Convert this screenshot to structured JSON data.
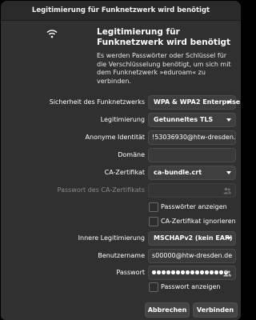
{
  "window": {
    "title": "Legitimierung für Funknetzwerk wird benötigt"
  },
  "header": {
    "icon": "wifi-icon",
    "title": "Legitimierung für Funknetzwerk wird benötigt",
    "description": "Es werden Passwörter oder Schlüssel für die Verschlüsselung benötigt, um sich mit dem Funknetzwerk »eduroam« zu verbinden."
  },
  "form": {
    "security": {
      "label": "Sicherheit des Funknetzwerks",
      "value": "WPA & WPA2 Enterprise"
    },
    "authentication": {
      "label": "Legitimierung",
      "value": "Getunneltes TLS"
    },
    "anonymous_identity": {
      "label": "Anonyme Identität",
      "value": "!53036930@htw-dresden.de"
    },
    "domain": {
      "label": "Domäne",
      "value": ""
    },
    "ca_certificate": {
      "label": "CA-Zertifikat",
      "value": "ca-bundle.crt"
    },
    "ca_password": {
      "label": "Passwort des CA-Zertifikats",
      "value": ""
    },
    "show_passwords": {
      "label": "Passwörter anzeigen",
      "checked": false
    },
    "ignore_ca": {
      "label": "CA-Zertifikat ignorieren",
      "checked": false
    },
    "inner_auth": {
      "label": "Innere Legitimierung",
      "value": "MSCHAPv2 (kein EAP)"
    },
    "username": {
      "label": "Benutzername",
      "value": "s00000@htw-dresden.de"
    },
    "password": {
      "label": "Passwort",
      "masked_length": 16
    },
    "show_password": {
      "label": "Passwort anzeigen",
      "checked": false
    }
  },
  "buttons": {
    "cancel": "Abbrechen",
    "connect": "Verbinden"
  },
  "colors": {
    "window_bg": "#303030",
    "titlebar_bg": "#2a2a2a",
    "control_bg": "#3f3f3f"
  }
}
